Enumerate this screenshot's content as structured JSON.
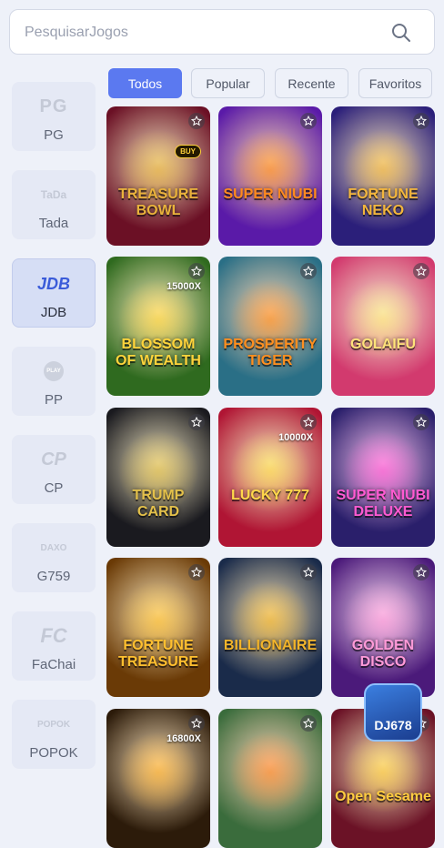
{
  "search": {
    "placeholder": "PesquisarJogos",
    "icon": "search-icon"
  },
  "tabs": [
    {
      "label": "Todos",
      "active": true
    },
    {
      "label": "Popular",
      "active": false
    },
    {
      "label": "Recente",
      "active": false
    },
    {
      "label": "Favoritos",
      "active": false
    }
  ],
  "sidebar": {
    "items": [
      {
        "label": "PG",
        "logo": "PG"
      },
      {
        "label": "Tada",
        "logo": "TaDa"
      },
      {
        "label": "JDB",
        "logo": "JDB",
        "active": true
      },
      {
        "label": "PP",
        "logo": "PLAY"
      },
      {
        "label": "CP",
        "logo": "CP"
      },
      {
        "label": "G759",
        "logo": "DAXO"
      },
      {
        "label": "FaChai",
        "logo": "FC"
      },
      {
        "label": "POPOK",
        "logo": "POPOK"
      }
    ]
  },
  "games": [
    {
      "title": "TREASURE BOWL",
      "buy_label": "BUY",
      "bg": "#6b1025",
      "accent": "#e9b23b"
    },
    {
      "title": "SUPER NIUBI",
      "bg": "#5a1aa8",
      "accent": "#ff8a1f"
    },
    {
      "title": "FORTUNE NEKO",
      "bg": "#2b1f7a",
      "accent": "#f3b63c"
    },
    {
      "title": "BLOSSOM OF WEALTH",
      "badge": "15000X",
      "bg": "#2f6a1f",
      "accent": "#ffd43b"
    },
    {
      "title": "PROSPERITY TIGER",
      "bg": "#2a6f86",
      "accent": "#ff8f1f"
    },
    {
      "title": "GOLAIFU",
      "bg": "#d23a6e",
      "accent": "#ffe27a"
    },
    {
      "title": "TRUMP CARD",
      "bg": "#1a1a1f",
      "accent": "#e3c04a"
    },
    {
      "title": "LUCKY 777",
      "badge": "10000X",
      "bg": "#b01534",
      "accent": "#ffd74a"
    },
    {
      "title": "SUPER NIUBI DELUXE",
      "bg": "#2a1f6b",
      "accent": "#ff5ad1"
    },
    {
      "title": "FORTUNE TREASURE",
      "bg": "#6a3a06",
      "accent": "#ffbf2f"
    },
    {
      "title": "BILLIONAIRE",
      "bg": "#1a2b4a",
      "accent": "#f2b42a"
    },
    {
      "title": "GOLDEN DISCO",
      "bg": "#4b1a7a",
      "accent": "#ff9ad8"
    },
    {
      "title": "",
      "badge": "16800X",
      "bg": "#2c1b0a",
      "accent": "#ffb12e"
    },
    {
      "title": "",
      "bg": "#3a6c3c",
      "accent": "#ff8b2a"
    },
    {
      "title": "Open Sesame",
      "bg": "#6b1226",
      "accent": "#ffcc3f"
    }
  ],
  "floating_logo": {
    "label": "DJ678"
  },
  "colors": {
    "accent": "#5b79f0",
    "background": "#eef1f9"
  }
}
